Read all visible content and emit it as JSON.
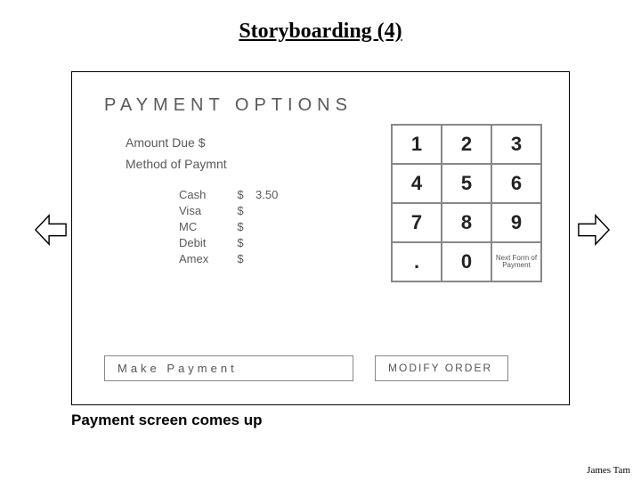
{
  "title": "Storyboarding (4)",
  "sketch": {
    "heading": "PAYMENT  OPTIONS",
    "amount_label": "Amount Due  $",
    "method_label": "Method of Paymnt",
    "methods": [
      {
        "label": "Cash",
        "sym": "$",
        "val": "3.50"
      },
      {
        "label": "Visa",
        "sym": "$",
        "val": ""
      },
      {
        "label": "MC",
        "sym": "$",
        "val": ""
      },
      {
        "label": "Debit",
        "sym": "$",
        "val": ""
      },
      {
        "label": "Amex",
        "sym": "$",
        "val": ""
      }
    ],
    "keypad": [
      [
        "1",
        "2",
        "3"
      ],
      [
        "4",
        "5",
        "6"
      ],
      [
        "7",
        "8",
        "9"
      ],
      [
        ".",
        "0",
        "Next Form of Payment"
      ]
    ],
    "make_payment": "Make   Payment",
    "modify_order": "MODIFY ORDER"
  },
  "caption": "Payment screen comes up",
  "author": "James Tam"
}
